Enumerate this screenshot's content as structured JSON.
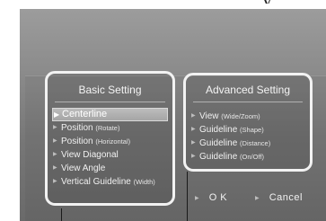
{
  "header": {
    "fragment": "y"
  },
  "basic_setting": {
    "title": "Basic Setting",
    "items": [
      {
        "label": "Centerline",
        "detail": "",
        "selected": true
      },
      {
        "label": "Position",
        "detail": "(Rotate)",
        "selected": false
      },
      {
        "label": "Position",
        "detail": "(Horizontal)",
        "selected": false
      },
      {
        "label": "View Diagonal",
        "detail": "",
        "selected": false
      },
      {
        "label": "View Angle",
        "detail": "",
        "selected": false
      },
      {
        "label": "Vertical Guideline",
        "detail": "(Width)",
        "selected": false
      }
    ]
  },
  "advanced_setting": {
    "title": "Advanced Setting",
    "items": [
      {
        "label": "View",
        "detail": "(Wide/Zoom)"
      },
      {
        "label": "Guideline",
        "detail": "(Shape)"
      },
      {
        "label": "Guideline",
        "detail": "(Distance)"
      },
      {
        "label": "Guideline",
        "detail": "(On/Off)"
      }
    ]
  },
  "buttons": {
    "ok_label": "O K",
    "cancel_label": "Cancel"
  },
  "icons": {
    "item_marker": "triangle-right-icon"
  },
  "colors": {
    "panel_border": "#f2f2f2",
    "text": "#f0f0f0",
    "selected_bg": "#b0b0b0",
    "screen_bg": "#8b8b8b"
  }
}
